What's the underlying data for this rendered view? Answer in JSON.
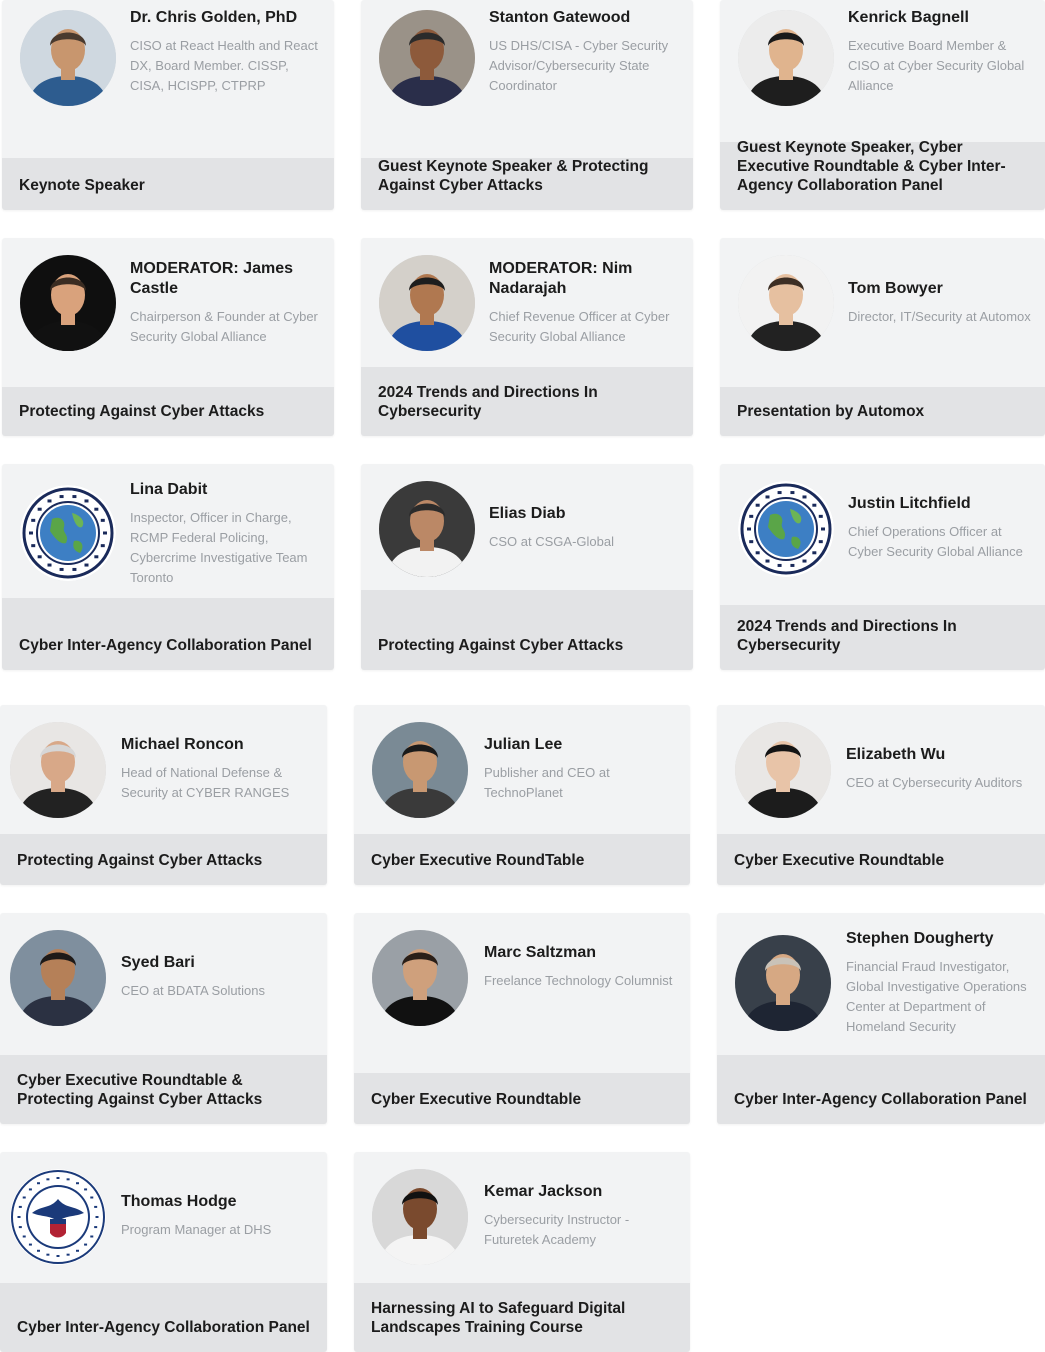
{
  "speakers": [
    {
      "name": "Dr. Chris Golden, PhD",
      "title": "CISO at React Health and React DX, Board Member. CISSP, CISA, HCISPP, CTPRP",
      "session": "Keynote Speaker",
      "avatar": "person-photo"
    },
    {
      "name": "Stanton Gatewood",
      "title": "US DHS/CISA - Cyber Security Advisor/Cybersecurity State Coordinator",
      "session": "Guest Keynote Speaker & Protecting Against Cyber Attacks",
      "avatar": "person-photo"
    },
    {
      "name": "Kenrick Bagnell",
      "title": "Executive Board Member & CISO at Cyber Security Global Alliance",
      "session": "Guest Keynote Speaker, Cyber Executive Roundtable & Cyber Inter-Agency Collaboration Panel",
      "avatar": "person-photo"
    },
    {
      "name": "MODERATOR: James Castle",
      "title": "Chairperson & Founder at Cyber Security Global Alliance",
      "session": "Protecting Against Cyber Attacks",
      "avatar": "person-photo"
    },
    {
      "name": "MODERATOR: Nim Nadarajah",
      "title": "Chief Revenue Officer at Cyber Security Global Alliance",
      "session": "2024 Trends and Directions In Cybersecurity",
      "avatar": "person-photo"
    },
    {
      "name": "Tom Bowyer",
      "title": "Director, IT/Security at Automox",
      "session": "Presentation by Automox",
      "avatar": "person-photo"
    },
    {
      "name": "Lina Dabit",
      "title": "Inspector, Officer in Charge, RCMP Federal Policing, Cybercrime Investigative Team Toronto",
      "session": "Cyber Inter-Agency Collaboration Panel",
      "avatar": "csga-logo"
    },
    {
      "name": "Elias Diab",
      "title": "CSO at CSGA-Global",
      "session": "Protecting Against Cyber Attacks",
      "avatar": "person-photo"
    },
    {
      "name": "Justin Litchfield",
      "title": "Chief Operations Officer at Cyber Security Global Alliance",
      "session": "2024 Trends and Directions In Cybersecurity",
      "avatar": "csga-logo"
    },
    {
      "name": "Michael Roncon",
      "title": "Head of National Defense & Security at CYBER RANGES",
      "session": "Protecting Against Cyber Attacks",
      "avatar": "person-photo"
    },
    {
      "name": "Julian Lee",
      "title": "Publisher and CEO at TechnoPlanet",
      "session": "Cyber Executive RoundTable",
      "avatar": "person-photo"
    },
    {
      "name": "Elizabeth Wu",
      "title": "CEO at Cybersecurity Auditors",
      "session": "Cyber Executive Roundtable",
      "avatar": "person-photo"
    },
    {
      "name": "Syed Bari",
      "title": "CEO at BDATA Solutions",
      "session": "Cyber Executive Roundtable & Protecting Against Cyber Attacks",
      "avatar": "person-photo"
    },
    {
      "name": "Marc Saltzman",
      "title": "Freelance Technology Columnist",
      "session": "Cyber Executive Roundtable",
      "avatar": "person-photo"
    },
    {
      "name": "Stephen Dougherty",
      "title": "Financial Fraud Investigator, Global Investigative Operations Center at Department of Homeland Security",
      "session": "Cyber Inter-Agency Collaboration Panel",
      "avatar": "person-photo"
    },
    {
      "name": "Thomas Hodge",
      "title": "Program Manager at DHS",
      "session": "Cyber Inter-Agency Collaboration Panel",
      "avatar": "dhs-seal"
    },
    {
      "name": "Kemar Jackson",
      "title": "Cybersecurity Instructor - Futuretek Academy",
      "session": "Harnessing AI to Safeguard Digital Landscapes Training Course",
      "avatar": "person-photo"
    }
  ],
  "logo_text": {
    "csga": "CYBER SECURITY GLOBAL ALLIANCE · SECURING OUR FUTURE",
    "dhs": "U.S. DEPARTMENT OF HOMELAND SECURITY"
  }
}
